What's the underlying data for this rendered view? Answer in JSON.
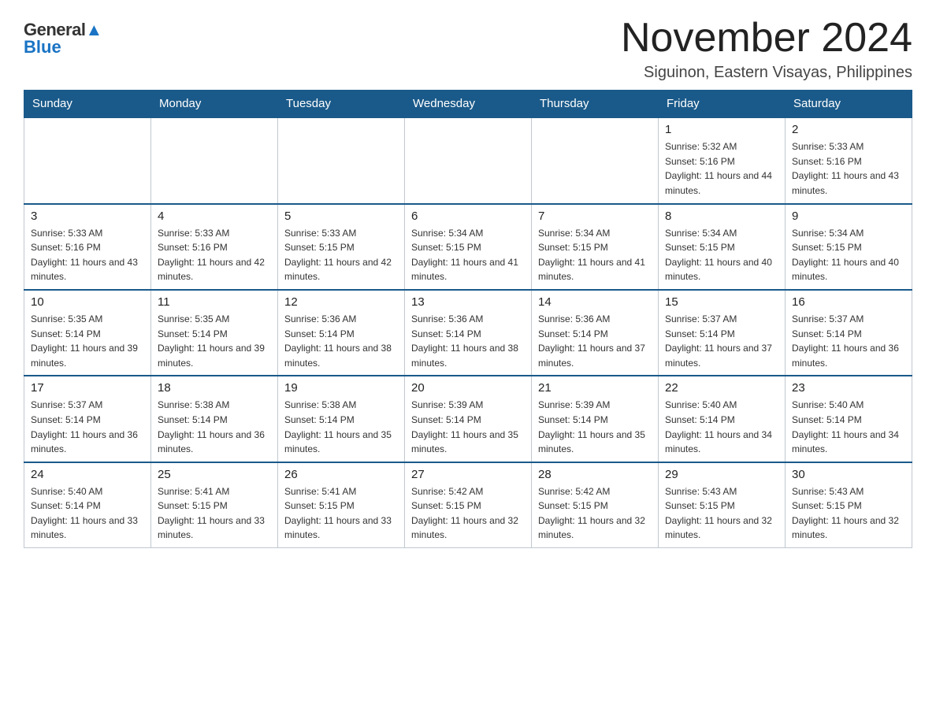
{
  "logo": {
    "general_text": "General",
    "blue_text": "Blue"
  },
  "title": {
    "month_year": "November 2024",
    "location": "Siguinon, Eastern Visayas, Philippines"
  },
  "days_of_week": [
    "Sunday",
    "Monday",
    "Tuesday",
    "Wednesday",
    "Thursday",
    "Friday",
    "Saturday"
  ],
  "weeks": [
    {
      "days": [
        {
          "number": "",
          "sunrise": "",
          "sunset": "",
          "daylight": "",
          "empty": true
        },
        {
          "number": "",
          "sunrise": "",
          "sunset": "",
          "daylight": "",
          "empty": true
        },
        {
          "number": "",
          "sunrise": "",
          "sunset": "",
          "daylight": "",
          "empty": true
        },
        {
          "number": "",
          "sunrise": "",
          "sunset": "",
          "daylight": "",
          "empty": true
        },
        {
          "number": "",
          "sunrise": "",
          "sunset": "",
          "daylight": "",
          "empty": true
        },
        {
          "number": "1",
          "sunrise": "Sunrise: 5:32 AM",
          "sunset": "Sunset: 5:16 PM",
          "daylight": "Daylight: 11 hours and 44 minutes.",
          "empty": false
        },
        {
          "number": "2",
          "sunrise": "Sunrise: 5:33 AM",
          "sunset": "Sunset: 5:16 PM",
          "daylight": "Daylight: 11 hours and 43 minutes.",
          "empty": false
        }
      ]
    },
    {
      "days": [
        {
          "number": "3",
          "sunrise": "Sunrise: 5:33 AM",
          "sunset": "Sunset: 5:16 PM",
          "daylight": "Daylight: 11 hours and 43 minutes.",
          "empty": false
        },
        {
          "number": "4",
          "sunrise": "Sunrise: 5:33 AM",
          "sunset": "Sunset: 5:16 PM",
          "daylight": "Daylight: 11 hours and 42 minutes.",
          "empty": false
        },
        {
          "number": "5",
          "sunrise": "Sunrise: 5:33 AM",
          "sunset": "Sunset: 5:15 PM",
          "daylight": "Daylight: 11 hours and 42 minutes.",
          "empty": false
        },
        {
          "number": "6",
          "sunrise": "Sunrise: 5:34 AM",
          "sunset": "Sunset: 5:15 PM",
          "daylight": "Daylight: 11 hours and 41 minutes.",
          "empty": false
        },
        {
          "number": "7",
          "sunrise": "Sunrise: 5:34 AM",
          "sunset": "Sunset: 5:15 PM",
          "daylight": "Daylight: 11 hours and 41 minutes.",
          "empty": false
        },
        {
          "number": "8",
          "sunrise": "Sunrise: 5:34 AM",
          "sunset": "Sunset: 5:15 PM",
          "daylight": "Daylight: 11 hours and 40 minutes.",
          "empty": false
        },
        {
          "number": "9",
          "sunrise": "Sunrise: 5:34 AM",
          "sunset": "Sunset: 5:15 PM",
          "daylight": "Daylight: 11 hours and 40 minutes.",
          "empty": false
        }
      ]
    },
    {
      "days": [
        {
          "number": "10",
          "sunrise": "Sunrise: 5:35 AM",
          "sunset": "Sunset: 5:14 PM",
          "daylight": "Daylight: 11 hours and 39 minutes.",
          "empty": false
        },
        {
          "number": "11",
          "sunrise": "Sunrise: 5:35 AM",
          "sunset": "Sunset: 5:14 PM",
          "daylight": "Daylight: 11 hours and 39 minutes.",
          "empty": false
        },
        {
          "number": "12",
          "sunrise": "Sunrise: 5:36 AM",
          "sunset": "Sunset: 5:14 PM",
          "daylight": "Daylight: 11 hours and 38 minutes.",
          "empty": false
        },
        {
          "number": "13",
          "sunrise": "Sunrise: 5:36 AM",
          "sunset": "Sunset: 5:14 PM",
          "daylight": "Daylight: 11 hours and 38 minutes.",
          "empty": false
        },
        {
          "number": "14",
          "sunrise": "Sunrise: 5:36 AM",
          "sunset": "Sunset: 5:14 PM",
          "daylight": "Daylight: 11 hours and 37 minutes.",
          "empty": false
        },
        {
          "number": "15",
          "sunrise": "Sunrise: 5:37 AM",
          "sunset": "Sunset: 5:14 PM",
          "daylight": "Daylight: 11 hours and 37 minutes.",
          "empty": false
        },
        {
          "number": "16",
          "sunrise": "Sunrise: 5:37 AM",
          "sunset": "Sunset: 5:14 PM",
          "daylight": "Daylight: 11 hours and 36 minutes.",
          "empty": false
        }
      ]
    },
    {
      "days": [
        {
          "number": "17",
          "sunrise": "Sunrise: 5:37 AM",
          "sunset": "Sunset: 5:14 PM",
          "daylight": "Daylight: 11 hours and 36 minutes.",
          "empty": false
        },
        {
          "number": "18",
          "sunrise": "Sunrise: 5:38 AM",
          "sunset": "Sunset: 5:14 PM",
          "daylight": "Daylight: 11 hours and 36 minutes.",
          "empty": false
        },
        {
          "number": "19",
          "sunrise": "Sunrise: 5:38 AM",
          "sunset": "Sunset: 5:14 PM",
          "daylight": "Daylight: 11 hours and 35 minutes.",
          "empty": false
        },
        {
          "number": "20",
          "sunrise": "Sunrise: 5:39 AM",
          "sunset": "Sunset: 5:14 PM",
          "daylight": "Daylight: 11 hours and 35 minutes.",
          "empty": false
        },
        {
          "number": "21",
          "sunrise": "Sunrise: 5:39 AM",
          "sunset": "Sunset: 5:14 PM",
          "daylight": "Daylight: 11 hours and 35 minutes.",
          "empty": false
        },
        {
          "number": "22",
          "sunrise": "Sunrise: 5:40 AM",
          "sunset": "Sunset: 5:14 PM",
          "daylight": "Daylight: 11 hours and 34 minutes.",
          "empty": false
        },
        {
          "number": "23",
          "sunrise": "Sunrise: 5:40 AM",
          "sunset": "Sunset: 5:14 PM",
          "daylight": "Daylight: 11 hours and 34 minutes.",
          "empty": false
        }
      ]
    },
    {
      "days": [
        {
          "number": "24",
          "sunrise": "Sunrise: 5:40 AM",
          "sunset": "Sunset: 5:14 PM",
          "daylight": "Daylight: 11 hours and 33 minutes.",
          "empty": false
        },
        {
          "number": "25",
          "sunrise": "Sunrise: 5:41 AM",
          "sunset": "Sunset: 5:15 PM",
          "daylight": "Daylight: 11 hours and 33 minutes.",
          "empty": false
        },
        {
          "number": "26",
          "sunrise": "Sunrise: 5:41 AM",
          "sunset": "Sunset: 5:15 PM",
          "daylight": "Daylight: 11 hours and 33 minutes.",
          "empty": false
        },
        {
          "number": "27",
          "sunrise": "Sunrise: 5:42 AM",
          "sunset": "Sunset: 5:15 PM",
          "daylight": "Daylight: 11 hours and 32 minutes.",
          "empty": false
        },
        {
          "number": "28",
          "sunrise": "Sunrise: 5:42 AM",
          "sunset": "Sunset: 5:15 PM",
          "daylight": "Daylight: 11 hours and 32 minutes.",
          "empty": false
        },
        {
          "number": "29",
          "sunrise": "Sunrise: 5:43 AM",
          "sunset": "Sunset: 5:15 PM",
          "daylight": "Daylight: 11 hours and 32 minutes.",
          "empty": false
        },
        {
          "number": "30",
          "sunrise": "Sunrise: 5:43 AM",
          "sunset": "Sunset: 5:15 PM",
          "daylight": "Daylight: 11 hours and 32 minutes.",
          "empty": false
        }
      ]
    }
  ]
}
